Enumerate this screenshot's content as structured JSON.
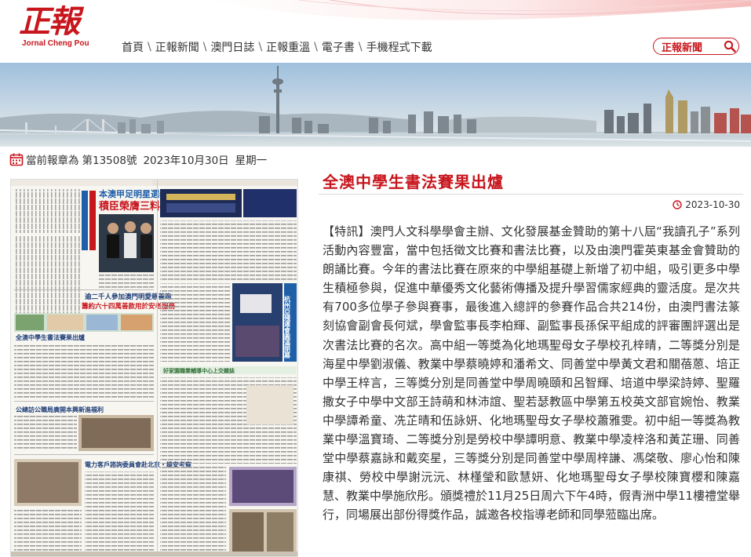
{
  "site": {
    "logo_cn": "正報",
    "logo_en": "Jornal Cheng Pou"
  },
  "nav": {
    "items": [
      "首頁",
      "正報新聞",
      "澳門日誌",
      "正報重溫",
      "電子書",
      "手機程式下載"
    ],
    "separator": "\\"
  },
  "search": {
    "label": "正報新聞",
    "icon": "search-icon"
  },
  "issue": {
    "prefix": "當前報章為",
    "number": "第13508號",
    "date": "2023年10月30日",
    "weekday": "星期一"
  },
  "newspaper_page": {
    "headline_main": "本澳甲足明星選舉2023",
    "headline_sub": "積臣榮膺三料足球先生",
    "side_headline_left": "培正工作坊傳授職場溝通技巧",
    "story_1": "逾二千人參加澳門明愛慈善跑",
    "story_1_sub": "籌約六十四萬善款用於安老服務",
    "story_2": "全澳中學生書法賽果出爐",
    "story_3": "公總訪公職局廣開本興新進福利",
    "story_4": "電力客戶諮詢委員會赴北京・雄安考察",
    "side_headline_right": "杭州亞殘運會圓滿閉幕",
    "banner_ad": "好家園職業輔導中心上交雜誌"
  },
  "article": {
    "title": "全澳中學生書法賽果出爐",
    "date": "2023-10-30",
    "body": "【特訊】澳門人文科學學會主辦、文化發展基金贊助的第十八屆“我讀孔子”系列活動內容豐富，當中包括徵文比賽和書法比賽，以及由澳門霍英東基金會贊助的朗誦比賽。今年的書法比賽在原來的中學組基礎上新增了初中組，吸引更多中學生積極參與，促進中華優秀文化藝術傳播及提升學習儒家經典的靈活度。是次共有700多位學子參與賽事，最後進入總評的參賽作品合共214份，由澳門書法篆刻協會副會長何斌，學會監事長李柏輝、副監事長孫保平組成的評審團評選出是次書法比賽的名次。高中組一等獎為化地瑪聖母女子學校孔梓晴，二等獎分別是海星中學劉淑儀、教業中學蔡曉婷和潘希文、同善堂中學黃文君和關蓓蒽、培正中學王梓言，三等獎分別是同善堂中學周曉頤和呂智輝、培道中學梁詩婷、聖羅撒女子中學中文部王詩萌和林沛誼、聖若瑟教區中學第五校英文部官婉怡、教業中學譚希童、冼芷晴和伍詠妍、化地瑪聖母女子學校蕭雅雯。初中組一等獎為教業中學溫寶琦、二等獎分別是勞校中學譚明意、教業中學凌梓洛和黃芷珊、同善堂中學蔡嘉詠和戴奕星，三等獎分別是同善堂中學周梓謙、馮棨敬、廖心怡和陳康祺、勞校中學謝沅沅、林槿瑩和歐慧妍、化地瑪聖母女子學校陳寶櫻和陳嘉慧、教業中學施欣彤。頒獎禮於11月25日周六下午4時，假青洲中學11樓禮堂舉行，同場展出部份得獎作品，誠邀各校指導老師和同學蒞臨出席。"
  },
  "colors": {
    "brand_red": "#c8161d",
    "text": "#333333",
    "rule": "#d8d8d8"
  }
}
